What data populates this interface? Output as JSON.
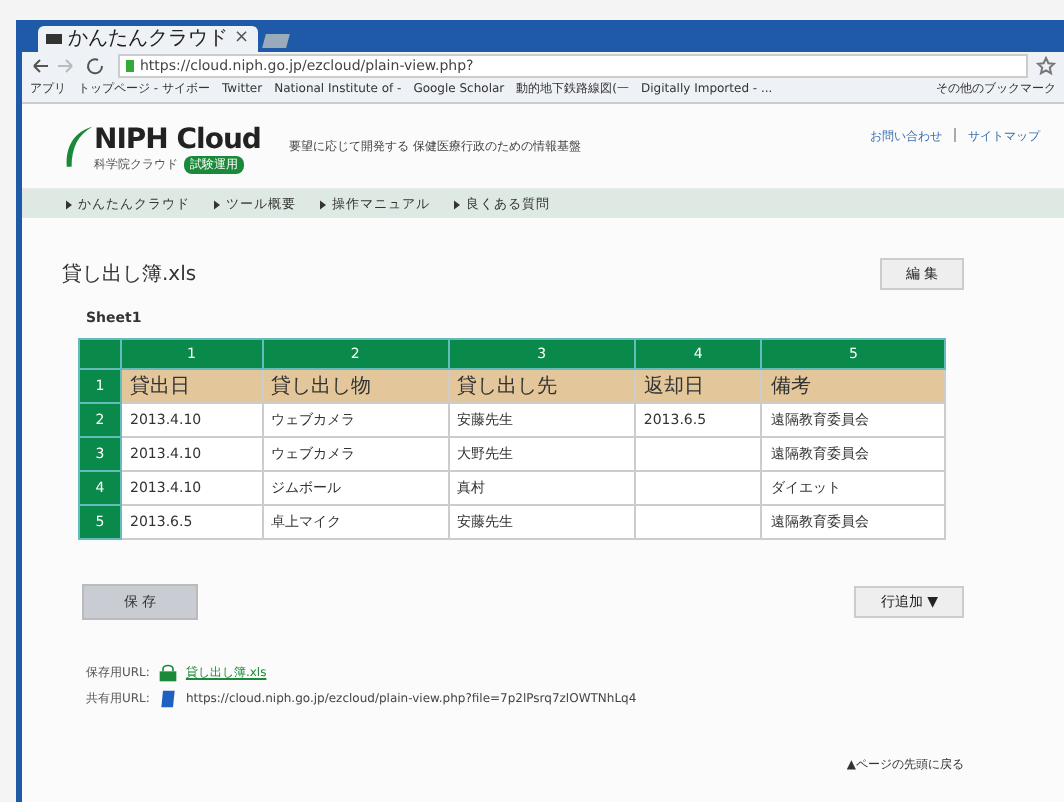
{
  "browser": {
    "tab_title": "かんたんクラウド",
    "tab_close": "×",
    "url": "https://cloud.niph.go.jp/ezcloud/plain-view.php?",
    "bookmarks": [
      "アプリ",
      "トップページ - サイボー",
      "Twitter",
      "National Institute of -",
      "Google Scholar",
      "動的地下鉄路線図(一",
      "Digitally Imported - ...",
      "その他のブックマーク"
    ]
  },
  "header": {
    "logo": "NIPH Cloud",
    "logo_sub": "科学院クラウド",
    "badge": "試験運用",
    "tagline": "要望に応じて開発する 保健医療行政のための情報基盤",
    "links": [
      "お問い合わせ",
      "サイトマップ"
    ]
  },
  "nav": [
    "かんたんクラウド",
    "ツール概要",
    "操作マニュアル",
    "良くある質問"
  ],
  "file_title": "貸し出し簿.xls",
  "edit_button": "編 集",
  "sheet_name": "Sheet1",
  "table": {
    "columns": [
      "1",
      "2",
      "3",
      "4",
      "5"
    ],
    "rows": [
      {
        "number": "1",
        "kind": "header",
        "cells": [
          "貸出日",
          "貸し出し物",
          "貸し出し先",
          "返却日",
          "備考"
        ]
      },
      {
        "number": "2",
        "kind": "data",
        "cells": [
          "2013.4.10",
          "ウェブカメラ",
          "安藤先生",
          "2013.6.5",
          "遠隔教育委員会"
        ]
      },
      {
        "number": "3",
        "kind": "data",
        "cells": [
          "2013.4.10",
          "ウェブカメラ",
          "大野先生",
          "",
          "遠隔教育委員会"
        ]
      },
      {
        "number": "4",
        "kind": "data",
        "cells": [
          "2013.4.10",
          "ジムボール",
          "真村",
          "",
          "ダイエット"
        ]
      },
      {
        "number": "5",
        "kind": "data",
        "cells": [
          "2013.6.5",
          "卓上マイク",
          "安藤先生",
          "",
          "遠隔教育委員会"
        ]
      }
    ]
  },
  "save_button": "保 存",
  "add_row_button": "行追加 ▼",
  "urls": [
    {
      "label": "保存用URL:",
      "kind": "download",
      "value": "貸し出し簿.xls"
    },
    {
      "label": "共有用URL:",
      "kind": "share",
      "value": "https://cloud.niph.go.jp/ezcloud/plain-view.php?file=7p2lPsrq7zlOWTNhLq4"
    }
  ],
  "back_to_top": "▲ページの先頭に戻る"
}
